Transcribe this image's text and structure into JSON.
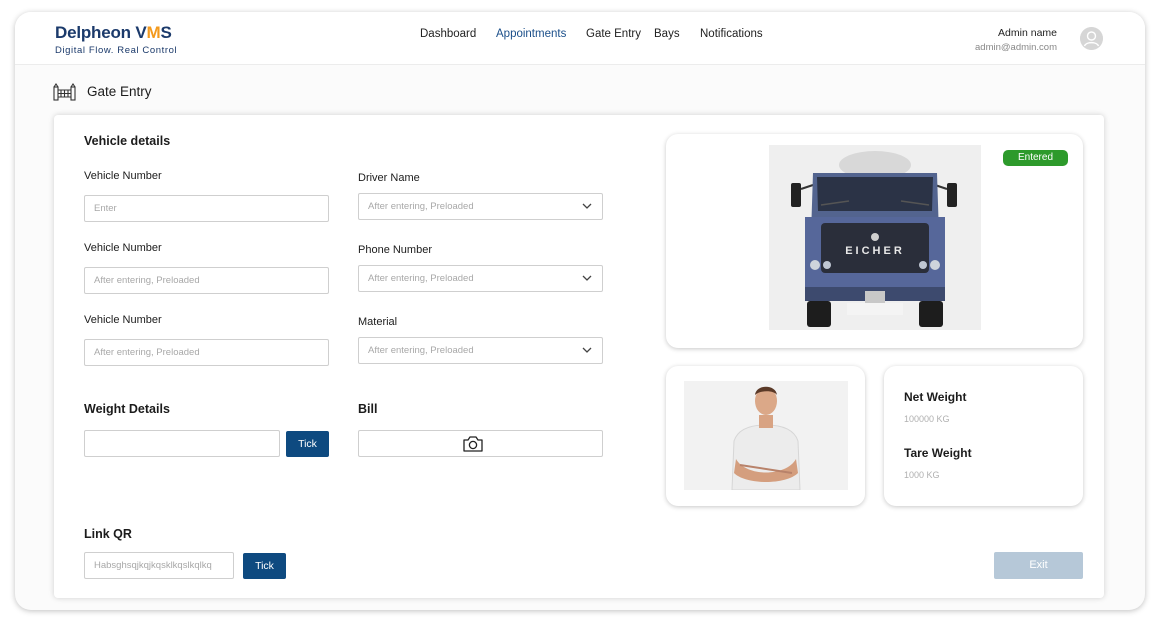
{
  "brand": {
    "name_main": "Delpheon V",
    "name_accent": "M",
    "name_end": "S",
    "tagline": "Digital Flow. Real Control"
  },
  "nav": {
    "items": [
      "Dashboard",
      "Appointments",
      "Gate Entry",
      "Bays",
      "Notifications"
    ],
    "active": "Appointments"
  },
  "user": {
    "name": "Admin name",
    "email": "admin@admin.com"
  },
  "page": {
    "title": "Gate Entry"
  },
  "vehicle_details": {
    "title": "Vehicle details",
    "left": [
      {
        "label": "Vehicle Number",
        "placeholder": "Enter"
      },
      {
        "label": "Vehicle Number",
        "placeholder": "After entering, Preloaded"
      },
      {
        "label": "Vehicle Number",
        "placeholder": "After entering, Preloaded"
      }
    ],
    "right": [
      {
        "label": "Driver Name",
        "placeholder": "After entering, Preloaded"
      },
      {
        "label": "Phone Number",
        "placeholder": "After entering, Preloaded"
      },
      {
        "label": "Material",
        "placeholder": "After entering, Preloaded"
      }
    ]
  },
  "weight_details": {
    "title": "Weight Details",
    "input_value": "",
    "tick_label": "Tick"
  },
  "bill": {
    "title": "Bill"
  },
  "link_qr": {
    "title": "Link QR",
    "value": "Habsghsqjkqjkqsklkqslkqlkq",
    "tick_label": "Tick"
  },
  "exit_label": "Exit",
  "status": {
    "label": "Entered",
    "color": "#2d9a2b"
  },
  "truck": {
    "brand_text": "EICHER"
  },
  "weights": {
    "net_label": "Net Weight",
    "net_value": "100000 KG",
    "tare_label": "Tare Weight",
    "tare_value": "1000 KG"
  },
  "colors": {
    "primary": "#0e4a80",
    "brand": "#1b3a6b",
    "accent": "#f39a1e",
    "exit_disabled": "#b6c8d8"
  },
  "icons": [
    "gate-icon",
    "camera-icon",
    "chevron-down-icon",
    "user-avatar-icon"
  ]
}
